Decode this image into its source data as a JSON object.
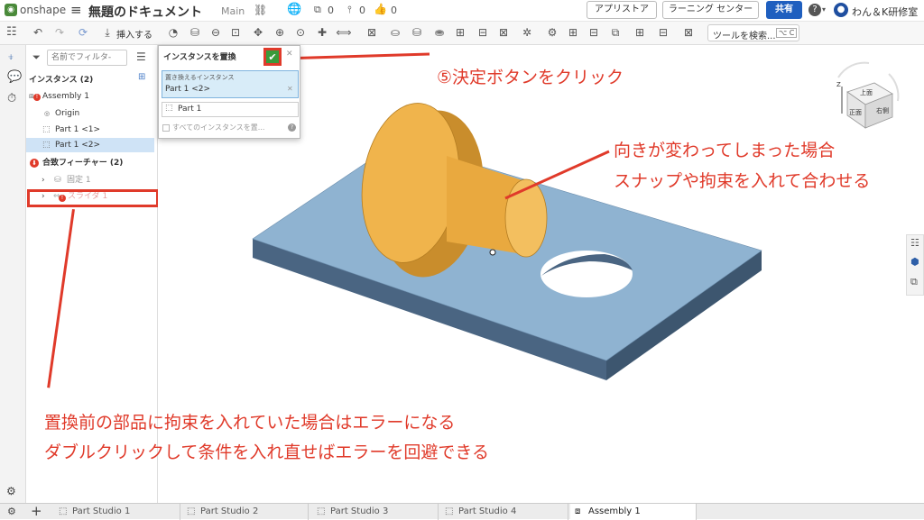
{
  "header": {
    "logo_text": "onshape",
    "doc_title": "無題のドキュメント",
    "branch": "Main",
    "count_versions": "0",
    "count_branches": "0",
    "count_likes": "0",
    "appstore_label": "アプリストア",
    "learning_label": "ラーニング センター",
    "share_label": "共有",
    "help_label": "?",
    "user_label": "わん＆K研修室"
  },
  "toolbar": {
    "insert_label": "挿入する",
    "search_tools_label": "ツールを検索...",
    "search_shortcut": "⌥ C"
  },
  "left_panel": {
    "filter_placeholder": "名前でフィルタ-",
    "instances_header": "インスタンス (2)",
    "assembly_name": "Assembly 1",
    "origin": "Origin",
    "part1": "Part 1 <1>",
    "part2": "Part 1 <2>",
    "mate_header": "合致フィーチャー (2)",
    "fixed": "固定 1",
    "slider": "スライダ 1"
  },
  "dialog": {
    "title": "インスタンスを置換",
    "field_label": "置き換えるインスタンス",
    "selected_instance": "Part 1 <2>",
    "replacement_part": "Part 1",
    "all_instances_label": "すべてのインスタンスを置..."
  },
  "viewcube": {
    "top": "上面",
    "front": "正面",
    "right": "右側",
    "z_axis": "Z"
  },
  "bottom_tabs": [
    "Part Studio 1",
    "Part Studio 2",
    "Part Studio 3",
    "Part Studio 4",
    "Assembly 1"
  ],
  "annotations": {
    "step5": "⑤決定ボタンをクリック",
    "orient_line1": "向きが変わってしまった場合",
    "orient_line2": "スナップや拘束を入れて合わせる",
    "error_line1": "置換前の部品に拘束を入れていた場合はエラーになる",
    "error_line2": "ダブルクリックして条件を入れ直せばエラーを回避できる"
  },
  "colors": {
    "accent_red": "#e03a2a",
    "share_blue": "#1f5fbf",
    "confirm_green": "#3a9a3a",
    "plate_top": "#8fb3d1",
    "part_orange": "#f0b44c",
    "selected_row": "#cfe3f6"
  }
}
